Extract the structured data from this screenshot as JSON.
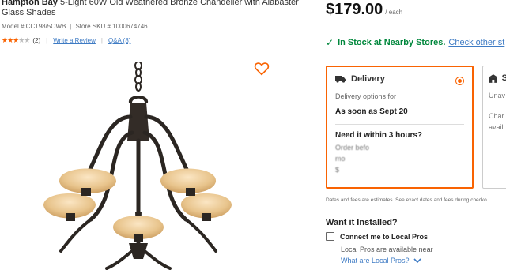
{
  "product": {
    "brand": "Hampton Bay",
    "name": "5-Light 60W Old Weathered Bronze Chandelier with Alabaster Glass Shades",
    "model": "Model # CC198/5OWB",
    "store_sku": "Store SKU # 1000674746",
    "rating_stars": 3,
    "rating_max": 5,
    "review_count": "(2)",
    "write_review": "Write a Review",
    "qa": "Q&A (8)"
  },
  "price": {
    "amount": "$179.00",
    "unit": "/ each"
  },
  "stock": {
    "status": "In Stock at Nearby Stores.",
    "link": "Check other st"
  },
  "delivery": {
    "title": "Delivery",
    "options_label": "Delivery options for",
    "date": "As soon as Sept 20",
    "need_title": "Need it within 3 hours?",
    "need_line1": "Order befo",
    "need_line2": "mo",
    "need_line3": "$"
  },
  "pickup": {
    "title_initial": "S",
    "line1": "Unav",
    "line2": "Char",
    "line3": "avail"
  },
  "fees_note": "Dates and fees are estimates. See exact dates and fees during checko",
  "install": {
    "title": "Want it Installed?",
    "connect_label": "Connect me to Local Pros",
    "available_text": "Local Pros are available near",
    "what_link": "What are Local Pros?"
  },
  "colors": {
    "accent": "#f96302",
    "link": "#3e7bc4",
    "stock_green": "#00873c"
  },
  "icons": [
    "heart-icon",
    "truck-icon",
    "store-icon",
    "check-icon",
    "chevron-down-icon",
    "star-icon"
  ]
}
